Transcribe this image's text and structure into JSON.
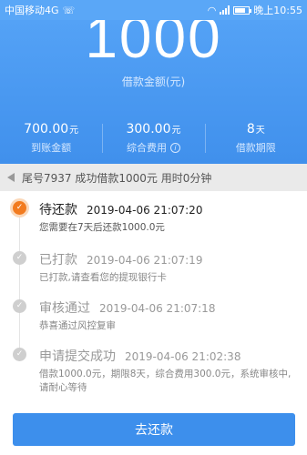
{
  "status_bar": {
    "carrier": "中国移动4G",
    "time": "晚上10:55"
  },
  "header": {
    "amount": "1000",
    "amount_label": "借款金额(元)",
    "stats": [
      {
        "value": "700.00",
        "unit": "元",
        "label": "到账金额"
      },
      {
        "value": "300.00",
        "unit": "元",
        "label": "综合费用"
      },
      {
        "value": "8",
        "unit": "天",
        "label": "借款期限"
      }
    ]
  },
  "notice": "尾号7937 成功借款1000元 用时0分钟",
  "timeline": [
    {
      "title": "待还款",
      "time": "2019-04-06 21:07:20",
      "desc": "您需要在7天后还款1000.0元",
      "current": true
    },
    {
      "title": "已打款",
      "time": "2019-04-06 21:07:19",
      "desc": "已打款,请查看您的提现银行卡",
      "current": false
    },
    {
      "title": "审核通过",
      "time": "2019-04-06 21:07:18",
      "desc": "恭喜通过风控复审",
      "current": false
    },
    {
      "title": "申请提交成功",
      "time": "2019-04-06 21:02:38",
      "desc": "借款1000.0元，期限8天，综合费用300.0元，系统审核中,请耐心等待",
      "current": false
    }
  ],
  "button": {
    "label": "去还款"
  },
  "colors": {
    "primary": "#4090ec",
    "active_step": "#f27b1f"
  }
}
